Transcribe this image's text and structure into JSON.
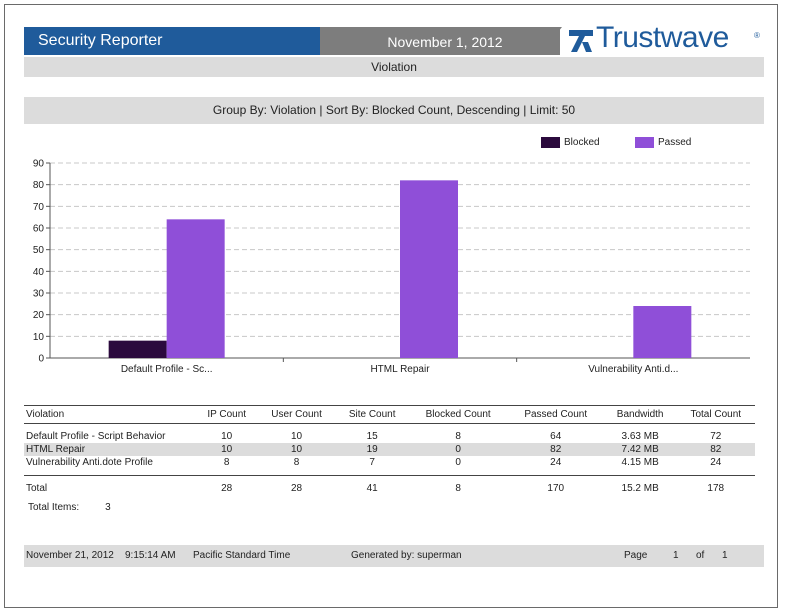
{
  "header": {
    "app_title": "Security Reporter",
    "date": "November 1, 2012",
    "brand": "Trustwave",
    "brand_mark": "®",
    "colors": {
      "header_blue": "#1f5b9b",
      "date_grey": "#7d7d7d",
      "band_grey": "#dcdcdc"
    }
  },
  "section_title": "Violation",
  "group_line": "Group By: Violation | Sort By: Blocked Count, Descending | Limit: 50",
  "chart_data": {
    "type": "bar",
    "categories": [
      "Default Profile - Sc...",
      "HTML Repair",
      "Vulnerability Anti.d..."
    ],
    "series": [
      {
        "name": "Blocked",
        "values": [
          8,
          0,
          0
        ],
        "color": "#2b0a3d"
      },
      {
        "name": "Passed",
        "values": [
          64,
          82,
          24
        ],
        "color": "#8f4fd8"
      }
    ],
    "ylim": [
      0,
      90
    ],
    "yticks": [
      "0",
      "10",
      "20",
      "30",
      "40",
      "50",
      "60",
      "70",
      "80",
      "90"
    ],
    "grid": true,
    "legend_position": "top-right",
    "xlabel": "",
    "ylabel": ""
  },
  "table": {
    "columns": [
      "Violation",
      "IP Count",
      "User Count",
      "Site Count",
      "Blocked Count",
      "Passed Count",
      "Bandwidth",
      "Total Count"
    ],
    "rows": [
      [
        "Default Profile - Script Behavior",
        "10",
        "10",
        "15",
        "8",
        "64",
        "3.63 MB",
        "72"
      ],
      [
        "HTML Repair",
        "10",
        "10",
        "19",
        "0",
        "82",
        "7.42 MB",
        "82"
      ],
      [
        "Vulnerability Anti.dote Profile",
        "8",
        "8",
        "7",
        "0",
        "24",
        "4.15 MB",
        "24"
      ]
    ],
    "total": [
      "Total",
      "28",
      "28",
      "41",
      "8",
      "170",
      "15.2 MB",
      "178"
    ]
  },
  "total_items": {
    "label": "Total Items:",
    "value": "3"
  },
  "footer": {
    "date": "November 21, 2012",
    "time": "9:15:14 AM",
    "timezone": "Pacific Standard Time",
    "generated_by": "Generated by: superman",
    "page_label": "Page",
    "page": "1",
    "of_label": "of",
    "pages": "1"
  }
}
